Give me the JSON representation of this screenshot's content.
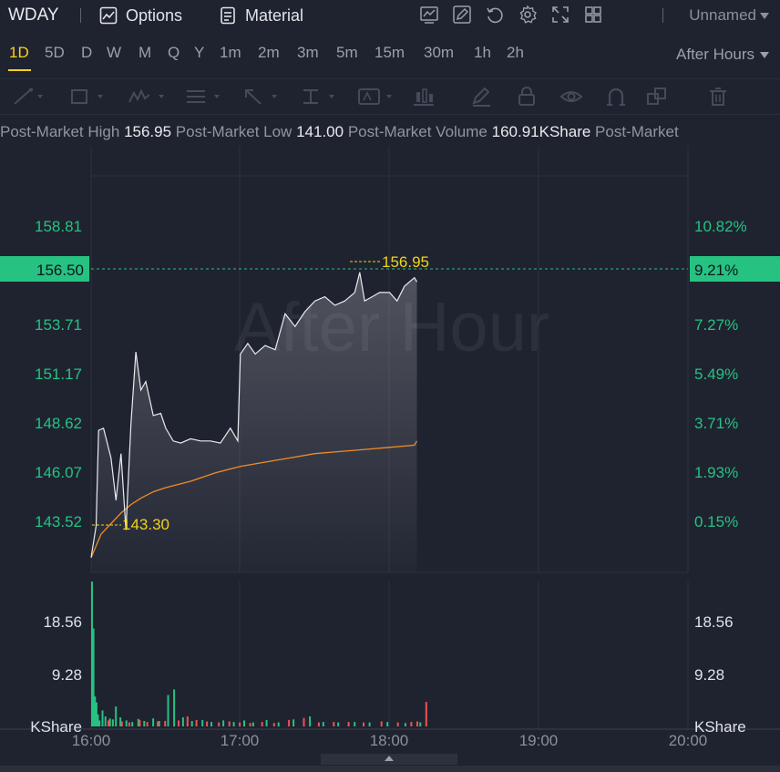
{
  "header": {
    "ticker": "WDAY",
    "options_label": "Options",
    "material_label": "Material",
    "layout_name": "Unnamed",
    "icons": [
      "chart-template-icon",
      "draw-icon",
      "replay-icon",
      "settings-icon",
      "fullscreen-icon",
      "layout-grid-icon"
    ]
  },
  "timeframes": {
    "items": [
      "1D",
      "5D",
      "D",
      "W",
      "M",
      "Q",
      "Y",
      "1m",
      "2m",
      "3m",
      "5m",
      "15m",
      "30m",
      "1h",
      "2h"
    ],
    "active": "1D",
    "session": "After Hours"
  },
  "drawing_tools": [
    "trend-line-icon",
    "rectangle-icon",
    "pattern-icon",
    "fib-icon",
    "arrow-icon",
    "measure-icon",
    "text-icon",
    "candle-icon",
    "pen-icon",
    "lock-icon",
    "eye-icon",
    "magnet-icon",
    "clone-icon",
    "trash-icon"
  ],
  "stats": [
    {
      "label": "Post-Market High",
      "value": "156.95"
    },
    {
      "label": "Post-Market Low",
      "value": "141.00"
    },
    {
      "label": "Post-Market Volume",
      "value": "160.91KShare"
    },
    {
      "label": "Post-Market",
      "value": ""
    }
  ],
  "colors": {
    "background": "#1f2330",
    "up": "#26c281",
    "down": "#f05252",
    "price_line": "#e9ebef",
    "avg_line": "#f08c2a",
    "highlight": "#f2d21c",
    "current_price_bg": "#26c281"
  },
  "watermark": "After Hour",
  "chart_data": {
    "type": "line",
    "y_axis_left": [
      "158.81",
      "153.71",
      "151.17",
      "148.62",
      "146.07",
      "143.52"
    ],
    "y_axis_right": [
      "10.82%",
      "7.27%",
      "5.49%",
      "3.71%",
      "1.93%",
      "0.15%"
    ],
    "current_price": "156.50",
    "current_pct": "9.21%",
    "high_marker": "156.95",
    "low_marker": "143.30",
    "x_axis": [
      "16:00",
      "17:00",
      "18:00",
      "19:00",
      "20:00"
    ],
    "ylim": [
      142.8,
      161.5
    ],
    "price_series": {
      "name": "",
      "x": [
        "16:00",
        "16:02",
        "16:03",
        "16:05",
        "16:08",
        "16:10",
        "16:12",
        "16:14",
        "16:16",
        "16:18",
        "16:20",
        "16:22",
        "16:25",
        "16:28",
        "16:30",
        "16:33",
        "16:36",
        "16:40",
        "16:44",
        "16:48",
        "16:52",
        "16:56",
        "16:59",
        "17:00",
        "17:03",
        "17:06",
        "17:10",
        "17:14",
        "17:18",
        "17:22",
        "17:26",
        "17:30",
        "17:34",
        "17:38",
        "17:42",
        "17:46",
        "17:48",
        "17:50",
        "17:53",
        "17:56",
        "18:00",
        "18:03",
        "18:06",
        "18:08",
        "18:10",
        "18:11"
      ],
      "values": [
        143.5,
        145.0,
        149.5,
        149.6,
        148.2,
        146.2,
        148.4,
        144.8,
        149.8,
        153.2,
        151.4,
        151.8,
        150.2,
        150.3,
        149.6,
        149.0,
        148.9,
        149.1,
        149.0,
        149.0,
        148.9,
        149.6,
        149.0,
        153.1,
        153.6,
        153.1,
        153.5,
        153.3,
        155.0,
        154.4,
        155.1,
        155.6,
        155.8,
        155.4,
        155.6,
        156.0,
        156.95,
        155.6,
        155.8,
        156.0,
        156.0,
        155.6,
        156.3,
        156.5,
        156.7,
        156.5
      ]
    },
    "avg_series": {
      "name": "",
      "x": [
        "16:00",
        "16:04",
        "16:08",
        "16:12",
        "16:16",
        "16:20",
        "16:25",
        "16:30",
        "16:40",
        "16:50",
        "17:00",
        "17:10",
        "17:20",
        "17:30",
        "17:40",
        "17:50",
        "18:00",
        "18:05",
        "18:10",
        "18:11"
      ],
      "values": [
        143.5,
        144.6,
        145.1,
        145.6,
        146.0,
        146.3,
        146.6,
        146.8,
        147.1,
        147.5,
        147.8,
        148.0,
        148.2,
        148.4,
        148.5,
        148.6,
        148.7,
        148.75,
        148.8,
        149.0
      ]
    },
    "volume": {
      "axis": [
        "18.56",
        "9.28"
      ],
      "unit": "KShare",
      "ylim": [
        0,
        29
      ],
      "bars_up": [
        [
          0.0,
          29.2
        ],
        [
          0.6,
          19.6
        ],
        [
          1.2,
          6.0
        ],
        [
          1.8,
          4.8
        ],
        [
          2.4,
          2.4
        ],
        [
          3.0,
          1.2
        ],
        [
          4.2,
          3.2
        ],
        [
          5.4,
          2.0
        ],
        [
          7.2,
          1.6
        ],
        [
          8.4,
          1.4
        ],
        [
          9.6,
          4.0
        ],
        [
          11.4,
          1.8
        ],
        [
          13.8,
          1.2
        ],
        [
          16.2,
          0.9
        ],
        [
          18.6,
          1.5
        ],
        [
          21.0,
          1.1
        ],
        [
          24.6,
          1.6
        ],
        [
          27.0,
          1.1
        ],
        [
          30.6,
          6.3
        ],
        [
          33.0,
          7.4
        ],
        [
          36.6,
          1.8
        ],
        [
          40.2,
          1.1
        ],
        [
          44.4,
          1.3
        ],
        [
          48.0,
          0.9
        ],
        [
          52.8,
          1.2
        ],
        [
          57.0,
          0.9
        ],
        [
          61.2,
          1.2
        ],
        [
          64.8,
          0.8
        ],
        [
          70.2,
          1.3
        ],
        [
          75.0,
          0.8
        ],
        [
          81.0,
          1.4
        ],
        [
          87.6,
          2.0
        ],
        [
          93.0,
          0.9
        ],
        [
          99.0,
          0.8
        ],
        [
          105.6,
          0.9
        ],
        [
          111.6,
          0.8
        ],
        [
          118.8,
          0.9
        ],
        [
          126.0,
          0.7
        ],
        [
          132.0,
          0.8
        ]
      ],
      "bars_down": [
        [
          6.6,
          1.2
        ],
        [
          12.0,
          1.0
        ],
        [
          15.0,
          0.8
        ],
        [
          19.2,
          1.3
        ],
        [
          22.2,
          0.9
        ],
        [
          26.4,
          1.0
        ],
        [
          29.4,
          1.1
        ],
        [
          34.8,
          1.2
        ],
        [
          38.4,
          2.0
        ],
        [
          42.0,
          1.3
        ],
        [
          46.2,
          1.0
        ],
        [
          51.0,
          0.8
        ],
        [
          55.2,
          1.0
        ],
        [
          59.4,
          0.8
        ],
        [
          63.6,
          0.7
        ],
        [
          68.4,
          0.9
        ],
        [
          73.2,
          0.7
        ],
        [
          79.2,
          1.3
        ],
        [
          85.2,
          1.7
        ],
        [
          91.2,
          0.8
        ],
        [
          97.2,
          0.9
        ],
        [
          103.2,
          0.9
        ],
        [
          109.2,
          0.8
        ],
        [
          116.4,
          1.0
        ],
        [
          123.0,
          0.8
        ],
        [
          128.4,
          0.9
        ],
        [
          130.8,
          1.0
        ],
        [
          134.4,
          4.9
        ]
      ]
    }
  }
}
